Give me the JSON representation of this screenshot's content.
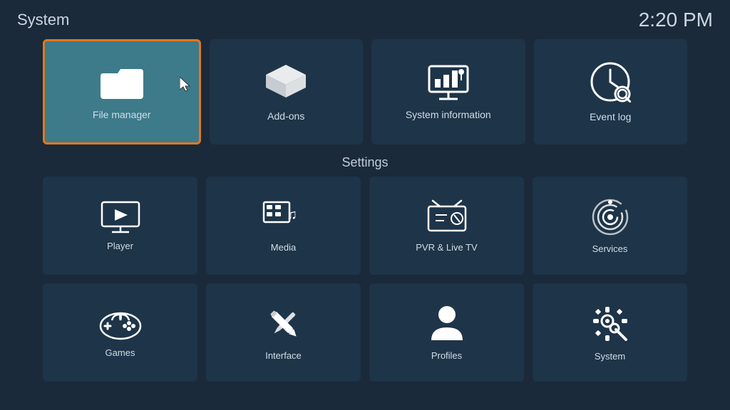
{
  "header": {
    "title": "System",
    "time": "2:20 PM"
  },
  "top_tiles": [
    {
      "id": "file-manager",
      "label": "File manager",
      "active": true
    },
    {
      "id": "add-ons",
      "label": "Add-ons",
      "active": false
    },
    {
      "id": "system-information",
      "label": "System information",
      "active": false
    },
    {
      "id": "event-log",
      "label": "Event log",
      "active": false
    }
  ],
  "settings_heading": "Settings",
  "settings_row1": [
    {
      "id": "player",
      "label": "Player"
    },
    {
      "id": "media",
      "label": "Media"
    },
    {
      "id": "pvr-live-tv",
      "label": "PVR & Live TV"
    },
    {
      "id": "services",
      "label": "Services"
    }
  ],
  "settings_row2": [
    {
      "id": "games",
      "label": "Games"
    },
    {
      "id": "interface",
      "label": "Interface"
    },
    {
      "id": "profiles",
      "label": "Profiles"
    },
    {
      "id": "system",
      "label": "System"
    }
  ]
}
